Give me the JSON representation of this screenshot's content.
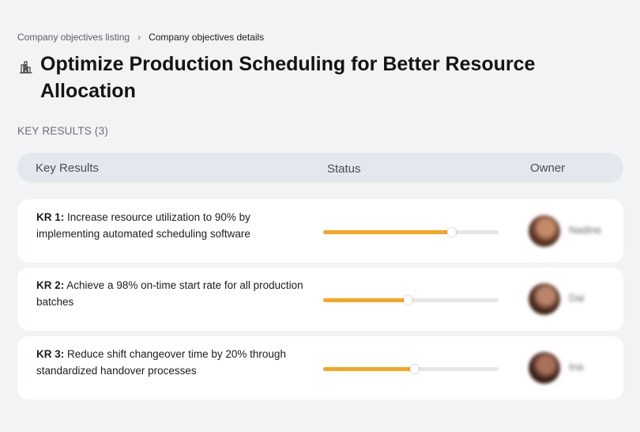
{
  "breadcrumb": {
    "parent": "Company objectives listing",
    "separator": "›",
    "current": "Company objectives details"
  },
  "objective": {
    "icon": "building-chart-icon",
    "title": "Optimize Production Scheduling for Better Resource Allocation"
  },
  "key_results_label": "KEY RESULTS (3)",
  "table": {
    "headers": {
      "key_results": "Key Results",
      "status": "Status",
      "owner": "Owner"
    },
    "rows": [
      {
        "id": "KR 1:",
        "text": "Increase resource utilization to 90% by implementing automated scheduling software",
        "progress": 0.73,
        "owner": "Nadine",
        "avatar_colors": [
          "#5a3422",
          "#c48a6a"
        ]
      },
      {
        "id": "KR 2:",
        "text": "Achieve a 98% on-time start rate for all production batches",
        "progress": 0.48,
        "owner": "Dai",
        "avatar_colors": [
          "#4a2a1c",
          "#b9846b"
        ]
      },
      {
        "id": "KR 3:",
        "text": "Reduce shift changeover time by 20% through standardized handover processes",
        "progress": 0.52,
        "owner": "Ina",
        "avatar_colors": [
          "#3d2219",
          "#a9705a"
        ]
      }
    ]
  },
  "colors": {
    "progress_fill": "#f5a623",
    "progress_track": "#e6e6e6",
    "header_bg": "#e3e7ee",
    "page_bg": "#f2f3f5"
  }
}
